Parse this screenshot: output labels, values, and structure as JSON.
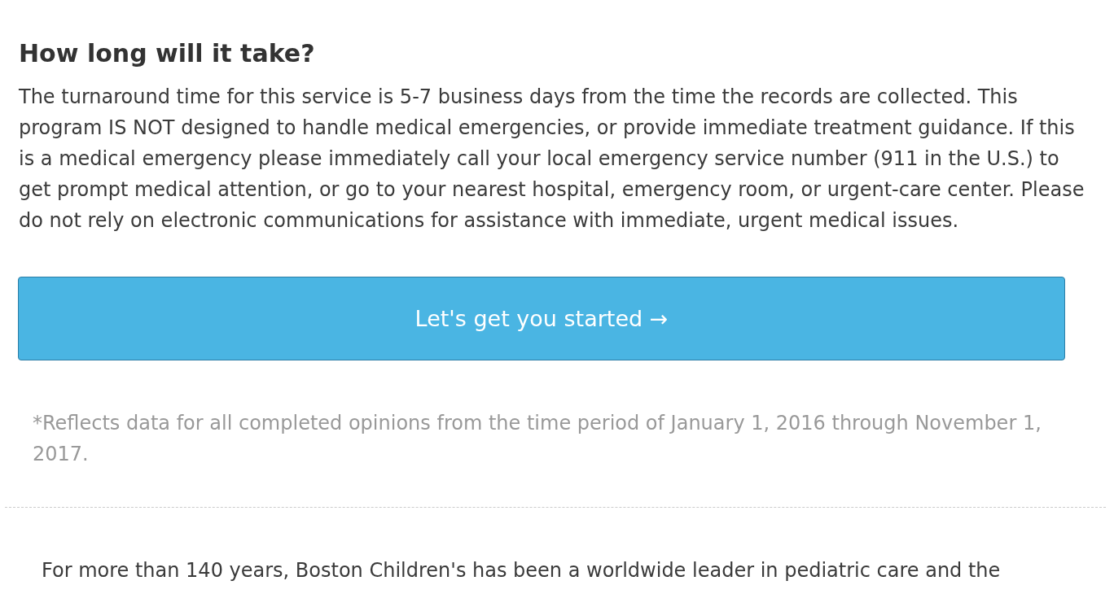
{
  "section": {
    "heading": "How long will it take?",
    "body": "The turnaround time for this service is 5-7 business days from the time the records are collected. This program IS NOT designed to handle medical emergencies, or provide immediate treatment guidance. If this is a medical emergency please immediately call your local emergency service number (911 in the U.S.) to get prompt medical attention, or go to your nearest hospital, emergency room, or urgent-care center. Please do not rely on electronic communications for assistance with immediate, urgent medical issues.",
    "button": "Let's get you started →",
    "footnote": "*Reflects data for all completed opinions from the time period of January 1, 2016 through November 1, 2017."
  },
  "about": {
    "text": "For more than 140 years, Boston Children's has been a worldwide leader in pediatric care and the"
  }
}
